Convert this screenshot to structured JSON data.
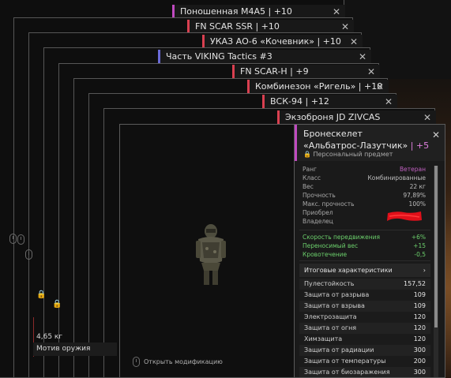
{
  "tabs": [
    {
      "label": "Поношенная М4А5 | +10",
      "accent": "#c04ac0"
    },
    {
      "label": "FN SCAR SSR | +10",
      "accent": "#d94050"
    },
    {
      "label": "УКАЗ АО-6 «Кочевник» | +10",
      "accent": "#d94050"
    },
    {
      "label": "Часть VIKING Tactics #3",
      "accent": "#6a6ad8"
    },
    {
      "label": "FN SCAR-H | +9",
      "accent": "#d94050"
    },
    {
      "label": "Комбинезон «Ригель» | +10",
      "accent": "#d94050"
    },
    {
      "label": "ВСК-94 | +12",
      "accent": "#d94050"
    },
    {
      "label": "Экзоброня JD ZIVCAS",
      "accent": "#d94050"
    }
  ],
  "close_glyph": "✕",
  "left_info": {
    "weight": "4,65 кг",
    "motive": "Мотив оружия"
  },
  "item": {
    "name_line1": "Бронескелет",
    "name_line2": "«Альбатрос-Лазутчик»",
    "level": "| +5",
    "personal": "Персональный предмет",
    "accent": "#c04ac0"
  },
  "stats": [
    {
      "k": "Ранг",
      "v": "Ветеран",
      "style": "purple"
    },
    {
      "k": "Класс",
      "v": "Комбинированные"
    },
    {
      "k": "Вес",
      "v": "22 кг"
    },
    {
      "k": "Прочность",
      "v": "97,89%"
    },
    {
      "k": "Макс. прочность",
      "v": "100%"
    },
    {
      "k": "Приобрел",
      "v": ""
    },
    {
      "k": "Владелец",
      "v": ""
    }
  ],
  "bonuses": [
    {
      "k": "Скорость передвижения",
      "v": "+6%"
    },
    {
      "k": "Переносимый вес",
      "v": "+15"
    },
    {
      "k": "Кровотечение",
      "v": "-0,5"
    }
  ],
  "itog_label": "Итоговые характеристики",
  "itog_arrow": "›",
  "table": [
    {
      "k": "Пулестойкость",
      "v": "157,52"
    },
    {
      "k": "Защита от разрыва",
      "v": "109"
    },
    {
      "k": "Защита от взрыва",
      "v": "109"
    },
    {
      "k": "Электрозащита",
      "v": "120"
    },
    {
      "k": "Защита от огня",
      "v": "120"
    },
    {
      "k": "Химзащита",
      "v": "120"
    },
    {
      "k": "Защита от радиации",
      "v": "300"
    },
    {
      "k": "Защита от температуры",
      "v": "200"
    },
    {
      "k": "Защита от биозаражения",
      "v": "300"
    }
  ],
  "open_mod": "Открыть модификацию",
  "lock_glyph": "🔒"
}
